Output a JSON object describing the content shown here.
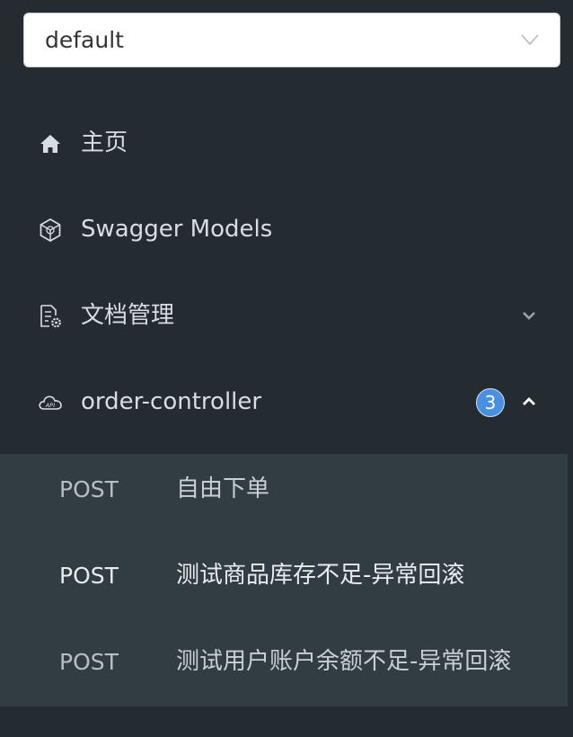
{
  "group_select": {
    "value": "default"
  },
  "nav": {
    "home": {
      "label": "主页",
      "icon": "home-icon"
    },
    "swagger_models": {
      "label": "Swagger Models",
      "icon": "cube-icon"
    },
    "doc_management": {
      "label": "文档管理",
      "icon": "document-settings-icon"
    },
    "order_controller": {
      "label": "order-controller",
      "icon": "cloud-api-icon",
      "badge": "3"
    }
  },
  "endpoints": [
    {
      "method": "POST",
      "label": "自由下单"
    },
    {
      "method": "POST",
      "label": "测试商品库存不足-异常回滚"
    },
    {
      "method": "POST",
      "label": "测试用户账户余额不足-异常回滚"
    }
  ],
  "colors": {
    "sidebar_bg": "#252c31",
    "submenu_bg": "#313c43",
    "badge_bg": "#4a90e2"
  }
}
